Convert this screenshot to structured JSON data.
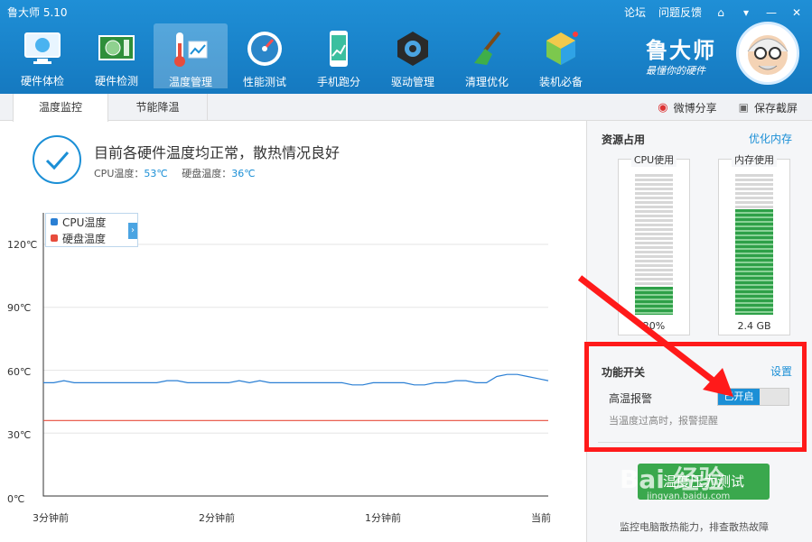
{
  "app": {
    "title": "鲁大师 5.10"
  },
  "top_links": {
    "forum": "论坛",
    "feedback": "问题反馈"
  },
  "toolbar": [
    {
      "label": "硬件体检",
      "icon": "monitor-check-icon"
    },
    {
      "label": "硬件检测",
      "icon": "circuit-board-icon"
    },
    {
      "label": "温度管理",
      "icon": "thermometer-icon",
      "active": true
    },
    {
      "label": "性能测试",
      "icon": "speedometer-icon"
    },
    {
      "label": "手机跑分",
      "icon": "phone-icon"
    },
    {
      "label": "驱动管理",
      "icon": "gear-box-icon"
    },
    {
      "label": "清理优化",
      "icon": "broom-icon"
    },
    {
      "label": "装机必备",
      "icon": "package-cube-icon"
    }
  ],
  "brand": {
    "name": "鲁大师",
    "slogan": "最懂你的硬件"
  },
  "tabs": [
    {
      "label": "温度监控",
      "active": true
    },
    {
      "label": "节能降温",
      "active": false
    }
  ],
  "tab_actions": {
    "weibo_share": "微博分享",
    "screenshot": "保存截屏"
  },
  "status": {
    "title": "目前各硬件温度均正常，散热情况良好",
    "cpu_label": "CPU温度：",
    "cpu_value": "53℃",
    "disk_label": "硬盘温度：",
    "disk_value": "36℃"
  },
  "chart_data": {
    "type": "line",
    "title": "",
    "xlabel": "",
    "ylabel": "",
    "x_ticks": [
      "3分钟前",
      "2分钟前",
      "1分钟前",
      "当前"
    ],
    "y_ticks": [
      "120℃",
      "90℃",
      "60℃",
      "30℃",
      "0℃"
    ],
    "ylim": [
      0,
      120
    ],
    "grid": true,
    "legend_position": "top-left",
    "series": [
      {
        "name": "CPU温度",
        "color": "#2a7fd4",
        "values": [
          54,
          54,
          55,
          54,
          54,
          54,
          54,
          54,
          54,
          54,
          54,
          54,
          55,
          55,
          54,
          54,
          54,
          54,
          54,
          55,
          54,
          55,
          54,
          54,
          54,
          54,
          54,
          54,
          54,
          54,
          53,
          53,
          54,
          54,
          54,
          54,
          53,
          53,
          54,
          54,
          55,
          55,
          54,
          54,
          57,
          58,
          58,
          57,
          56,
          55
        ]
      },
      {
        "name": "硬盘温度",
        "color": "#e74c3c",
        "values": [
          36,
          36,
          36,
          36,
          36,
          36,
          36,
          36,
          36,
          36,
          36,
          36,
          36,
          36,
          36,
          36,
          36,
          36,
          36,
          36,
          36,
          36,
          36,
          36,
          36,
          36,
          36,
          36,
          36,
          36,
          36,
          36,
          36,
          36,
          36,
          36,
          36,
          36,
          36,
          36,
          36,
          36,
          36,
          36,
          36,
          36,
          36,
          36,
          36,
          36
        ]
      }
    ]
  },
  "resources": {
    "title": "资源占用",
    "optimize_link": "优化内存",
    "cpu": {
      "label": "CPU使用",
      "value_text": "20%",
      "fill": 0.2
    },
    "memory": {
      "label": "内存使用",
      "value_text": "2.4 GB",
      "fill": 0.75
    }
  },
  "functions": {
    "title": "功能开关",
    "settings_link": "设置",
    "alarm_label": "高温报警",
    "alarm_state": "已开启",
    "alarm_desc": "当温度过高时，报警提醒"
  },
  "stress": {
    "button_label": "温度压力测试",
    "desc": "监控电脑散热能力，排查散热故障"
  },
  "watermark": {
    "text": "Bai 经验",
    "url": "jingyan.baidu.com"
  }
}
